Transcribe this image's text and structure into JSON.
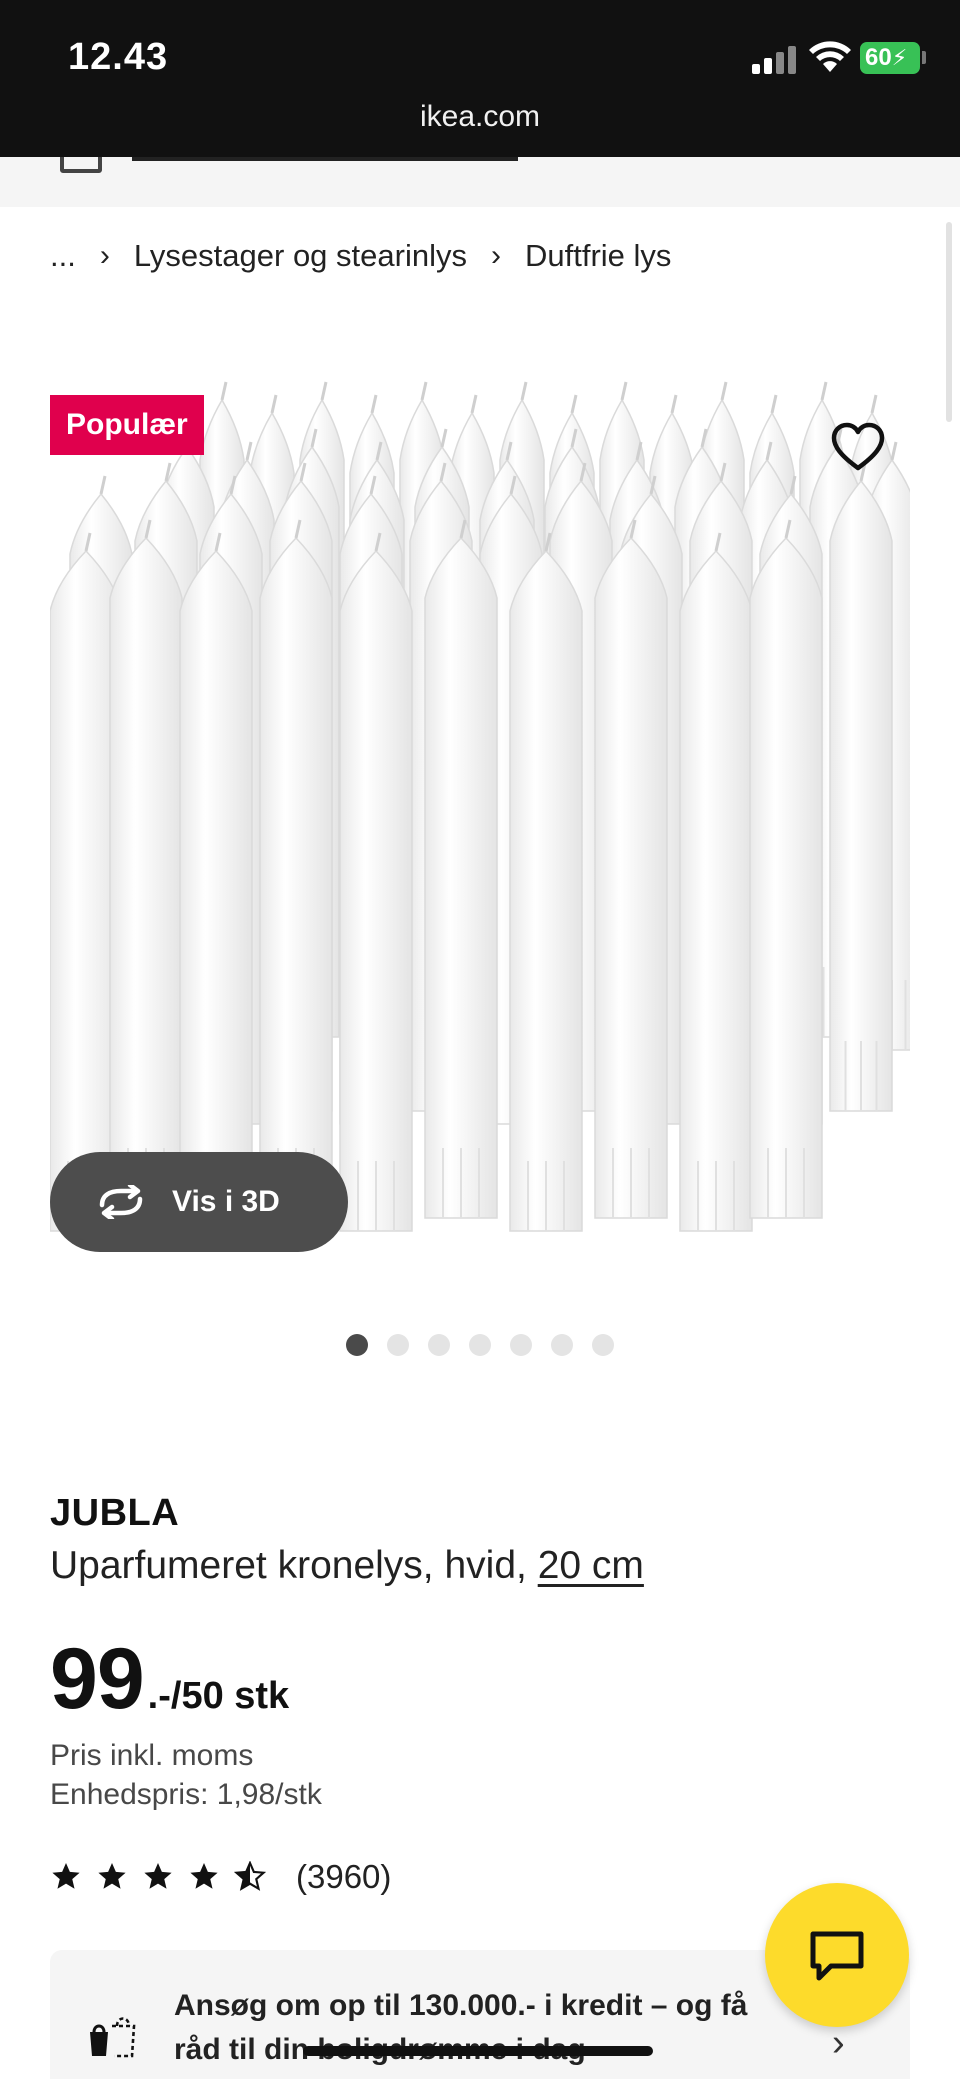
{
  "status_bar": {
    "time": "12.43",
    "url": "ikea.com",
    "battery": "60"
  },
  "breadcrumb": {
    "ellipsis": "...",
    "items": [
      "Lysestager og stearinlys",
      "Duftfrie lys"
    ]
  },
  "gallery": {
    "badge": "Populær",
    "view_3d_label": "Vis i 3D",
    "dot_count": 7,
    "active_dot": 0
  },
  "product": {
    "name": "JUBLA",
    "description": "Uparfumeret kronelys, hvid, ",
    "size": "20 cm",
    "price_main": "99",
    "price_suffix": ".-/50 stk",
    "price_note": "Pris inkl. moms",
    "unit_price": "Enhedspris: 1,98/stk",
    "rating_count": "(3960)",
    "rating_value": 4.5
  },
  "credit_banner": {
    "line1": "Ansøg om op til 130.000.- i kredit – og få",
    "line2": "råd til din boligdrømme i dag"
  },
  "colors": {
    "badge": "#e0004d",
    "chat_fab": "#fddb2b",
    "status_bar": "#111111"
  },
  "icons": {
    "favorite": "heart-icon",
    "rotate": "rotate-3d-icon",
    "chat": "chat-icon",
    "credit": "shopping-bag-icon"
  }
}
